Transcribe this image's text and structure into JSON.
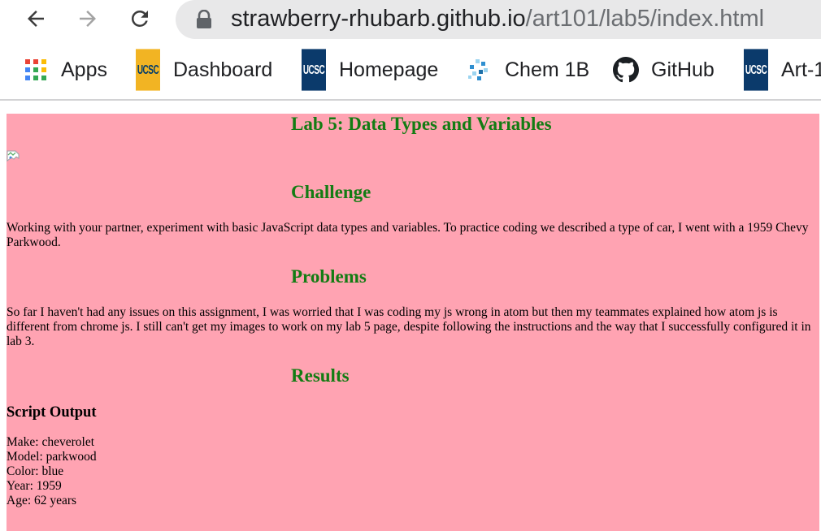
{
  "browser": {
    "url_host": "strawberry-rhubarb.github.io",
    "url_path": "/art101/lab5/index.html",
    "bookmarks": [
      {
        "label": "Apps",
        "icon": "apps-grid-icon"
      },
      {
        "label": "Dashboard",
        "icon": "ucsc-icon"
      },
      {
        "label": "Homepage",
        "icon": "ucsc-icon"
      },
      {
        "label": "Chem 1B",
        "icon": "chem-icon"
      },
      {
        "label": "GitHub",
        "icon": "github-icon"
      },
      {
        "label": "Art-1",
        "icon": "ucsc-icon"
      }
    ],
    "ucsc_text": "UCSC"
  },
  "page": {
    "background": "#ffa3b2",
    "heading_color": "#137c13",
    "title": "Lab 5: Data Types and Variables",
    "challenge_heading": "Challenge",
    "challenge_text": "Working with your partner, experiment with basic JavaScript data types and variables. To practice coding we described a type of car, I went with a 1959 Chevy Parkwood.",
    "problems_heading": "Problems",
    "problems_text": "So far I haven't had any issues on this assignment, I was worried that I was coding my js wrong in atom but then my teammates explained how atom js is different from chrome js. I still can't get my images to work on my lab 5 page, despite following the instructions and the way that I successfully configured it in lab 3.",
    "results_heading": "Results",
    "script_output_heading": "Script Output",
    "output_lines": [
      "Make: cheverolet",
      "Model: parkwood",
      "Color: blue",
      "Year: 1959",
      "Age: 62 years"
    ]
  }
}
